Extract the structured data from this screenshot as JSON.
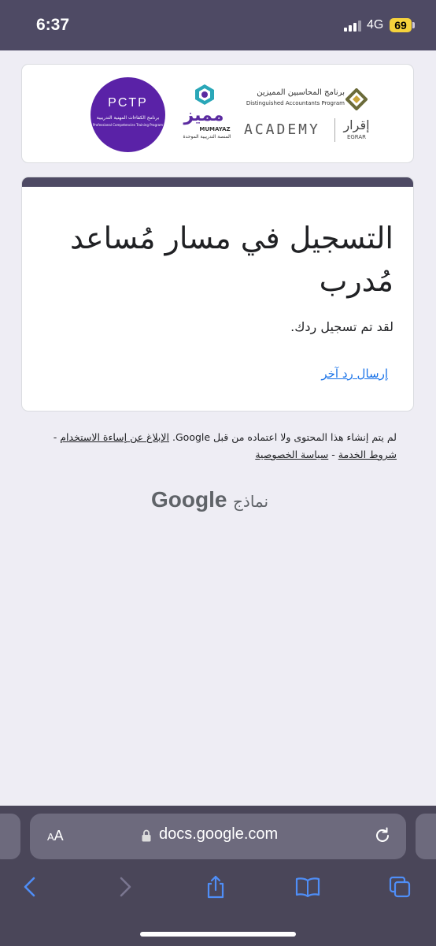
{
  "status_bar": {
    "time": "6:37",
    "network": "4G",
    "battery": "69",
    "battery_color": "#f5d23c"
  },
  "banner": {
    "pctp_title": "PCTP",
    "pctp_subtitle_ar": "برنامج الكفاءات المهنية التدريبية",
    "pctp_subtitle_en": "Professional Competencies Training Program",
    "mumayaz_ar": "مميز",
    "mumayaz_en": "MUMAYAZ",
    "mumayaz_sub_ar": "المنصة التدريبية الموحدة",
    "dap_ar": "برنامج المحاسبين المميزين",
    "dap_en": "Distinguished Accountants Program",
    "academy": "ACADEMY",
    "egrar_ar": "إقرار",
    "egrar_en": "EGRAR"
  },
  "form": {
    "title": "التسجيل في مسار مُساعد مُدرب",
    "confirmation": "لقد تم تسجيل ردك.",
    "another_response": "إرسال رد آخر",
    "accent_color": "#4e4a64"
  },
  "footer": {
    "disclaimer": "لم يتم إنشاء هذا المحتوى ولا اعتماده من قبل Google.",
    "report_abuse": "الإبلاغ عن إساءة الاستخدام",
    "separator": "-",
    "terms": "شروط الخدمة",
    "privacy": "سياسة الخصوصية",
    "google": "Google",
    "forms": "نماذج"
  },
  "browser": {
    "text_size_label_small": "A",
    "text_size_label_large": "A",
    "url": "docs.google.com",
    "icons": [
      "lock-icon",
      "reload-icon",
      "back-icon",
      "forward-icon",
      "share-icon",
      "bookmarks-icon",
      "tabs-icon"
    ]
  }
}
